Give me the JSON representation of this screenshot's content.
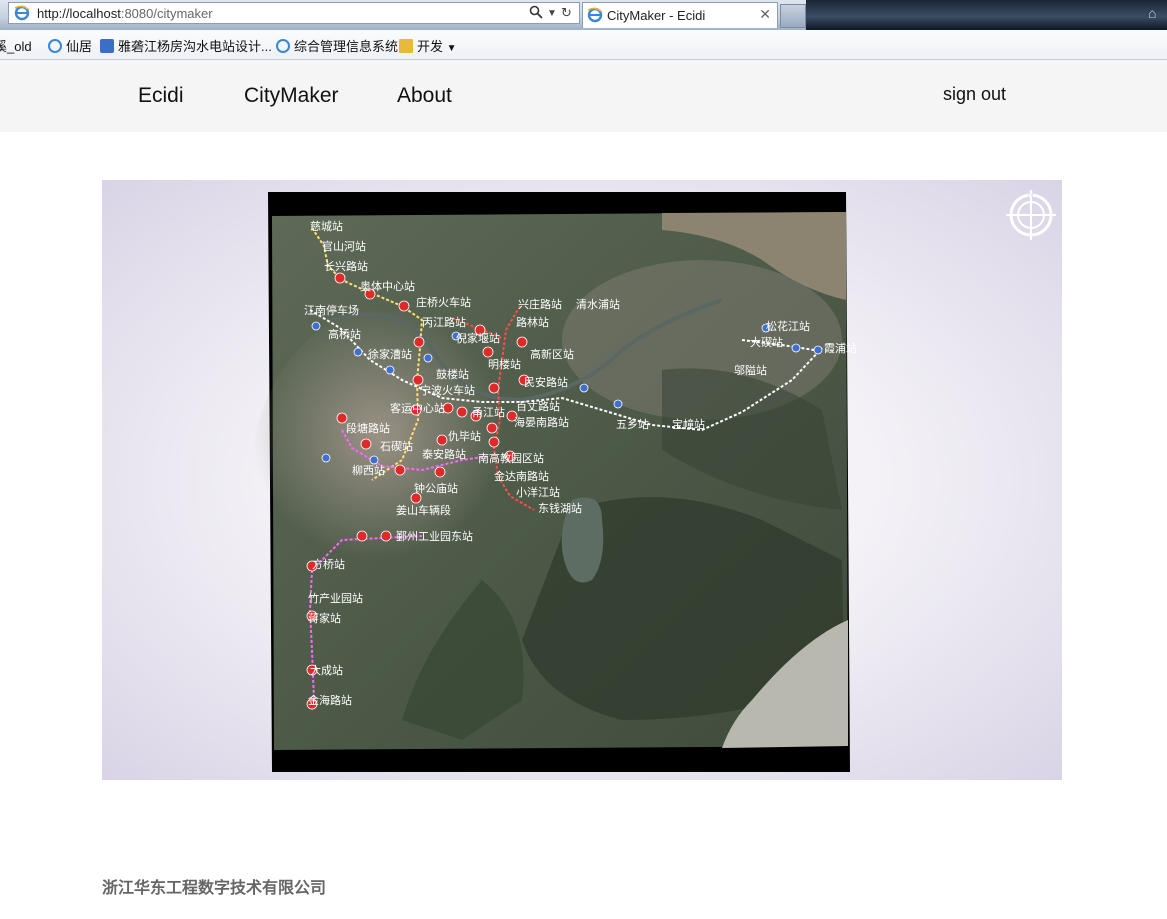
{
  "browser": {
    "url_host": "http://localhost",
    "url_rest": ":8080/citymaker",
    "tab_title": "CityMaker - Ecidi",
    "favorites": [
      {
        "label": "溪_old",
        "icon": "ie"
      },
      {
        "label": "仙居",
        "icon": "ie"
      },
      {
        "label": "雅砻江杨房沟水电站设计...",
        "icon": "power"
      },
      {
        "label": "综合管理信息系统",
        "icon": "ie"
      },
      {
        "label": "开发",
        "icon": "folder"
      }
    ]
  },
  "nav": {
    "brand": "Ecidi",
    "items": [
      "CityMaker",
      "About"
    ],
    "sign_out": "sign out"
  },
  "map": {
    "compass_letter": "N",
    "stations": [
      "慈城站",
      "官山河站",
      "长兴路站",
      "奥体中心站",
      "庄桥火车站",
      "丙江路站",
      "倪家堰站",
      "江南停车场",
      "高桥站",
      "徐家漕站",
      "鼓楼站",
      "宁波火车站",
      "客运中心站",
      "明楼站",
      "民安路站",
      "高新区站",
      "兴庄路站",
      "清水浦站",
      "路林站",
      "百丈路站",
      "海晏南路站",
      "五乡站",
      "宝幢站",
      "松花江站",
      "大碶站",
      "霞浦站",
      "邬隘站",
      "段塘路站",
      "石碶站",
      "泰安路站",
      "柳西站",
      "南高教园区站",
      "金达南路站",
      "小洋江站",
      "东钱湖站",
      "姜山车辆段",
      "鄞州工业园东站",
      "方桥站",
      "竹产业园站",
      "蒋家站",
      "大成站",
      "金海路站",
      "钟公庙站",
      "仇毕站",
      "甬江站"
    ]
  },
  "footer": {
    "company": "浙江华东工程数字技术有限公司"
  }
}
